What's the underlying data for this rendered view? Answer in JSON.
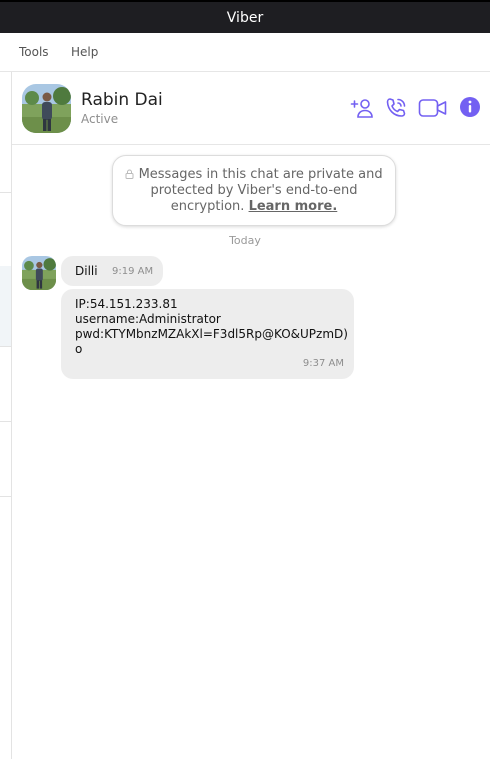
{
  "window": {
    "title": "Viber"
  },
  "menu": {
    "items": [
      "Tools",
      "Help"
    ]
  },
  "contact": {
    "name": "Rabin Dai",
    "status": "Active"
  },
  "header_icons": [
    "add-contact-icon",
    "phone-icon",
    "video-icon",
    "info-icon"
  ],
  "colors": {
    "accent": "#7360f2",
    "titlebar": "#1e1e22",
    "bubble": "#ededed"
  },
  "notice": {
    "text": "Messages in this chat are private and protected by Viber's end-to-end encryption.",
    "line1": "Messages in this chat are private and",
    "line2": "protected by Viber's end-to-end",
    "line3": "encryption.",
    "link": "Learn more."
  },
  "date_divider": "Today",
  "messages": [
    {
      "sender": "Dilli",
      "time": "9:19 AM"
    },
    {
      "lines": [
        "IP:54.151.233.81",
        "username:Administrator",
        "pwd:KTYMbnzMZAkXl=F3dl5Rp@KO&UPzmD)",
        "o"
      ],
      "time": "9:37 AM"
    }
  ]
}
